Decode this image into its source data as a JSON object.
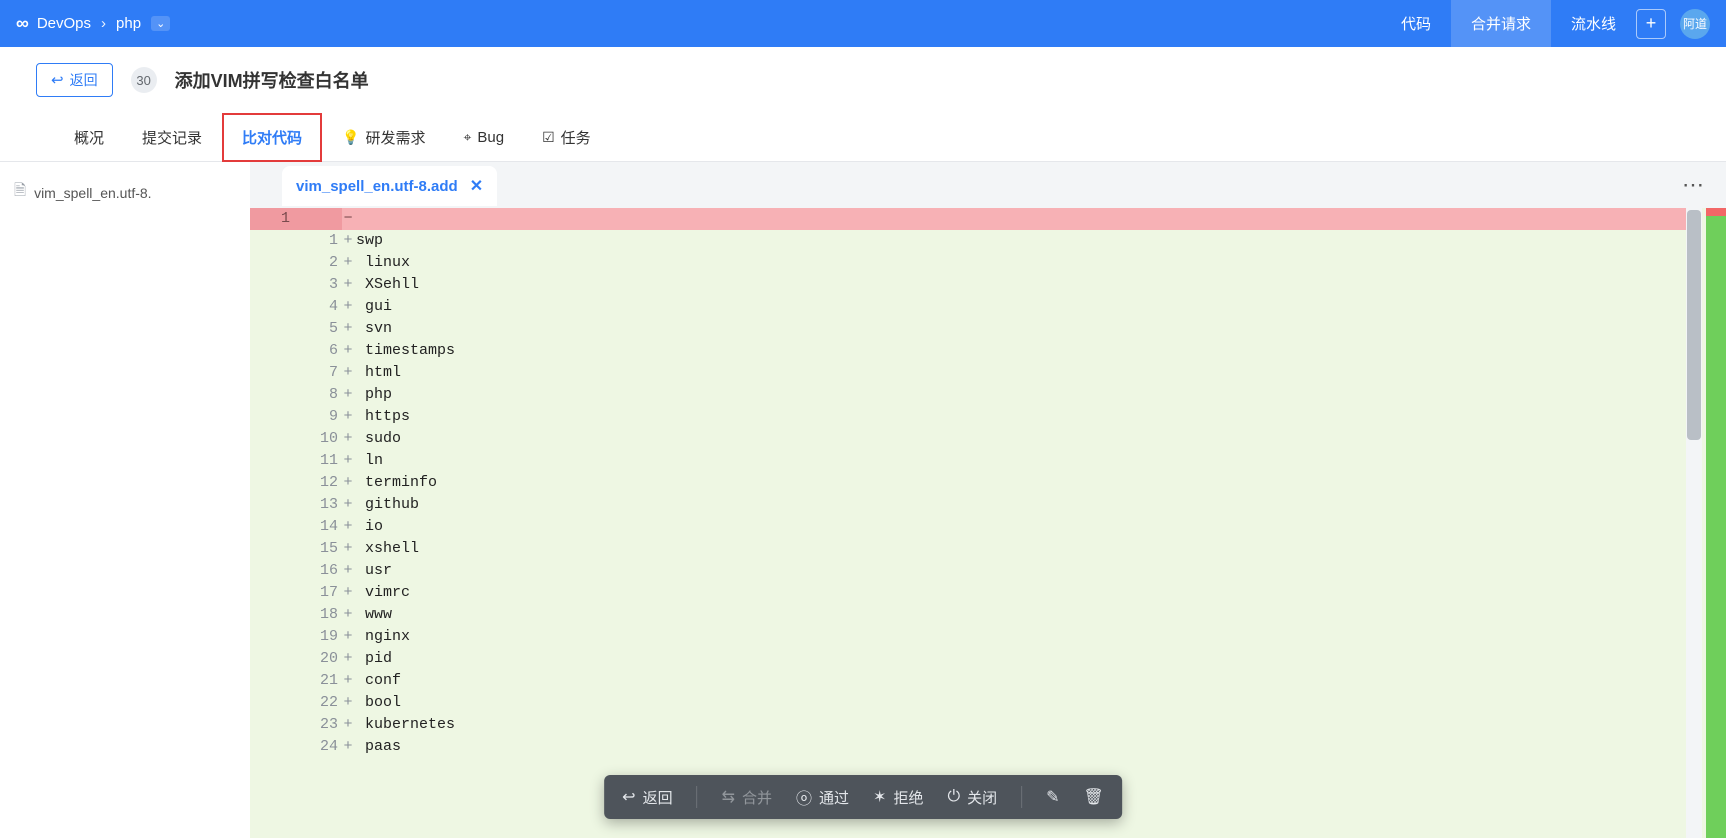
{
  "topbar": {
    "breadcrumb": [
      "DevOps",
      "php"
    ],
    "nav": [
      {
        "label": "代码",
        "active": false
      },
      {
        "label": "合并请求",
        "active": true
      },
      {
        "label": "流水线",
        "active": false
      }
    ],
    "avatar_text": "阿道"
  },
  "subheader": {
    "back_label": "返回",
    "mr_id": "30",
    "mr_title": "添加VIM拼写检查白名单"
  },
  "tabs": [
    {
      "label": "概况",
      "active": false,
      "icon": ""
    },
    {
      "label": "提交记录",
      "active": false,
      "icon": ""
    },
    {
      "label": "比对代码",
      "active": true,
      "icon": ""
    },
    {
      "label": "研发需求",
      "active": false,
      "icon": "bulb"
    },
    {
      "label": "Bug",
      "active": false,
      "icon": "bug"
    },
    {
      "label": "任务",
      "active": false,
      "icon": "check"
    }
  ],
  "sidebar": {
    "files": [
      {
        "name": "vim_spell_en.utf-8."
      }
    ]
  },
  "diff": {
    "tab_title": "vim_spell_en.utf-8.add",
    "removed_line_old_num": "1",
    "lines": [
      {
        "n": 1,
        "text": "swp"
      },
      {
        "n": 2,
        "text": " linux"
      },
      {
        "n": 3,
        "text": " XSehll"
      },
      {
        "n": 4,
        "text": " gui"
      },
      {
        "n": 5,
        "text": " svn"
      },
      {
        "n": 6,
        "text": " timestamps"
      },
      {
        "n": 7,
        "text": " html"
      },
      {
        "n": 8,
        "text": " php"
      },
      {
        "n": 9,
        "text": " https"
      },
      {
        "n": 10,
        "text": " sudo"
      },
      {
        "n": 11,
        "text": " ln"
      },
      {
        "n": 12,
        "text": " terminfo"
      },
      {
        "n": 13,
        "text": " github"
      },
      {
        "n": 14,
        "text": " io"
      },
      {
        "n": 15,
        "text": " xshell"
      },
      {
        "n": 16,
        "text": " usr"
      },
      {
        "n": 17,
        "text": " vimrc"
      },
      {
        "n": 18,
        "text": " www"
      },
      {
        "n": 19,
        "text": " nginx"
      },
      {
        "n": 20,
        "text": " pid"
      },
      {
        "n": 21,
        "text": " conf"
      },
      {
        "n": 22,
        "text": " bool"
      },
      {
        "n": 23,
        "text": " kubernetes"
      },
      {
        "n": 24,
        "text": " paas"
      }
    ]
  },
  "action_bar": {
    "back": "返回",
    "merge": "合并",
    "pass": "通过",
    "reject": "拒绝",
    "close": "关闭"
  }
}
